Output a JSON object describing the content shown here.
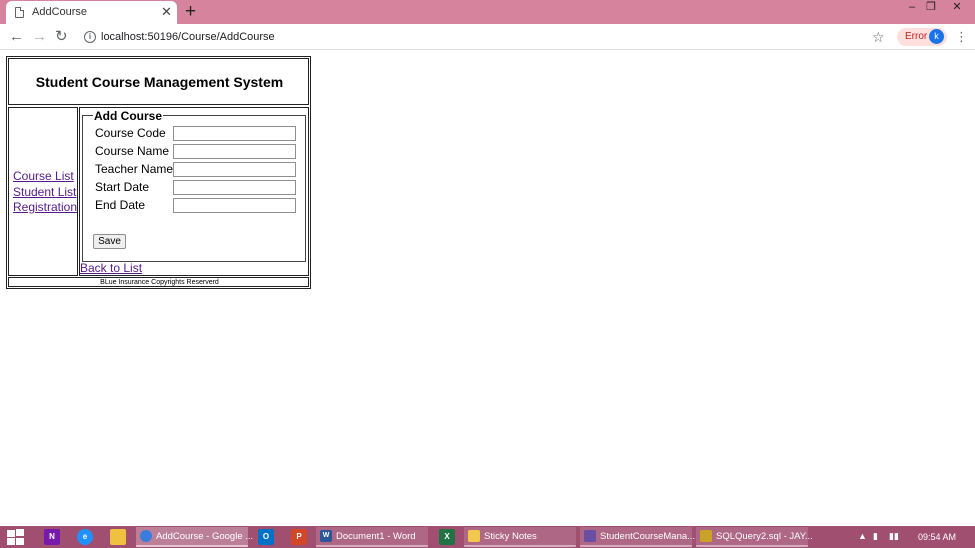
{
  "browser": {
    "tab_title": "AddCourse",
    "tab_close_glyph": "✕",
    "new_tab_glyph": "+",
    "window_controls": [
      "–",
      "❐",
      "✕"
    ],
    "url_host": "localhost:50196/Course/AddCourse",
    "error_label": "Error",
    "profile_initial": "k"
  },
  "page": {
    "title": "Student Course Management System",
    "nav_links": [
      "Course List",
      "Student List",
      "Registration"
    ],
    "form": {
      "legend": "Add Course",
      "fields": [
        {
          "label": "Course Code",
          "value": ""
        },
        {
          "label": "Course Name",
          "value": ""
        },
        {
          "label": "Teacher Name",
          "value": ""
        },
        {
          "label": "Start Date",
          "value": ""
        },
        {
          "label": "End Date",
          "value": ""
        }
      ],
      "save_label": "Save"
    },
    "back_link": "Back to List",
    "footer": "BLue Insurance Copyrights Reserverd"
  },
  "taskbar": {
    "items": [
      {
        "label": "AddCourse - Google ...",
        "icon": "chrome-icon",
        "icon_color": "#3b7ddd",
        "state": "active"
      },
      {
        "label": "Document1 - Word",
        "icon": "word-icon",
        "icon_color": "#2b579a",
        "state": "open",
        "icon_text": "W"
      },
      {
        "label": "Sticky Notes",
        "icon": "sticky-notes-icon",
        "icon_color": "#f2c94c",
        "state": "open"
      },
      {
        "label": "StudentCourseMana...",
        "icon": "visual-studio-icon",
        "icon_color": "#6a4ea1",
        "state": "open"
      },
      {
        "label": "SQLQuery2.sql - JAY...",
        "icon": "ssms-icon",
        "icon_color": "#c9a227",
        "state": "open"
      }
    ],
    "pinned": [
      {
        "icon": "onenote-icon",
        "text": "N",
        "color": "#7719aa"
      },
      {
        "icon": "ie-icon",
        "text": "e",
        "color": "#1e90ff"
      },
      {
        "icon": "file-explorer-icon",
        "text": "",
        "color": "#f0c040"
      },
      {
        "icon": "outlook-icon",
        "text": "O",
        "color": "#0072c6"
      },
      {
        "icon": "powerpoint-icon",
        "text": "P",
        "color": "#d24726"
      },
      {
        "icon": "excel-icon",
        "text": "X",
        "color": "#217346"
      }
    ],
    "clock": "09:54 AM"
  },
  "colors": {
    "tabstrip": "#d6839e",
    "taskbar": "#a14f70",
    "link_visited": "#551a8b"
  }
}
